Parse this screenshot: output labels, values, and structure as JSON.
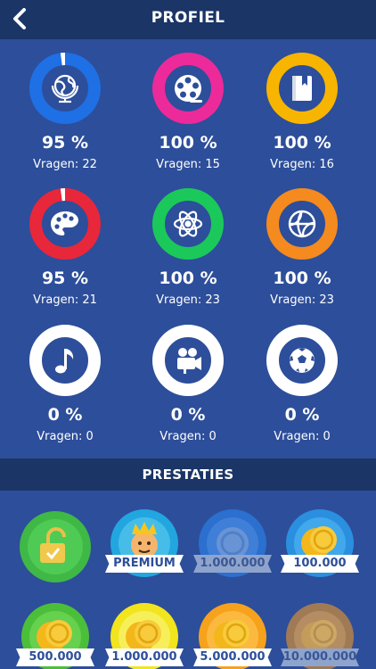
{
  "header": {
    "title": "PROFIEL",
    "back_icon": "chevron-left-icon"
  },
  "categories": [
    {
      "name": "aardrijkskunde",
      "icon": "globe-icon",
      "color": "#1f6fe5",
      "percent_label": "95 %",
      "vragen_label": "Vragen: 22",
      "progress": 0.95
    },
    {
      "name": "film",
      "icon": "film-reel-icon",
      "color": "#ec2a9a",
      "percent_label": "100 %",
      "vragen_label": "Vragen: 15",
      "progress": 1.0
    },
    {
      "name": "literatuur",
      "icon": "book-icon",
      "color": "#f7b500",
      "percent_label": "100 %",
      "vragen_label": "Vragen: 16",
      "progress": 1.0
    },
    {
      "name": "kunst",
      "icon": "palette-icon",
      "color": "#e8273a",
      "percent_label": "95 %",
      "vragen_label": "Vragen: 21",
      "progress": 0.95
    },
    {
      "name": "wetenschap",
      "icon": "atom-icon",
      "color": "#1bc95a",
      "percent_label": "100 %",
      "vragen_label": "Vragen: 23",
      "progress": 1.0
    },
    {
      "name": "sport",
      "icon": "basketball-icon",
      "color": "#f58a1f",
      "percent_label": "100 %",
      "vragen_label": "Vragen: 23",
      "progress": 1.0
    },
    {
      "name": "muziek",
      "icon": "music-note-icon",
      "color": "#ffffff",
      "percent_label": "0 %",
      "vragen_label": "Vragen: 0",
      "progress": 0
    },
    {
      "name": "films-tv",
      "icon": "movie-camera-icon",
      "color": "#ffffff",
      "percent_label": "0 %",
      "vragen_label": "Vragen: 0",
      "progress": 0
    },
    {
      "name": "voetbal",
      "icon": "soccer-ball-icon",
      "color": "#ffffff",
      "percent_label": "0 %",
      "vragen_label": "Vragen: 0",
      "progress": 0
    }
  ],
  "achievements_title": "PRESTATIES",
  "achievements": [
    {
      "icon": "unlocked-padlock-icon",
      "label": "",
      "color": "#3fb846",
      "unlocked": true
    },
    {
      "icon": "crowned-face-icon",
      "label": "PREMIUM",
      "color": "#22a6df",
      "unlocked": true
    },
    {
      "icon": "coin-icon",
      "label": "1.000.000",
      "color": "#2b6fcf",
      "unlocked": false
    },
    {
      "icon": "coin-icon",
      "label": "100.000",
      "color": "#2b8fe0",
      "unlocked": true
    },
    {
      "icon": "coin-icon",
      "label": "500.000",
      "color": "#4cbf3a",
      "unlocked": true
    },
    {
      "icon": "coin-icon",
      "label": "1.000.000",
      "color": "#f2e51d",
      "unlocked": true
    },
    {
      "icon": "coin-icon",
      "label": "5.000.000",
      "color": "#f7a21c",
      "unlocked": true
    },
    {
      "icon": "coin-icon",
      "label": "10.000.000",
      "color": "#a07a55",
      "unlocked": false
    }
  ]
}
